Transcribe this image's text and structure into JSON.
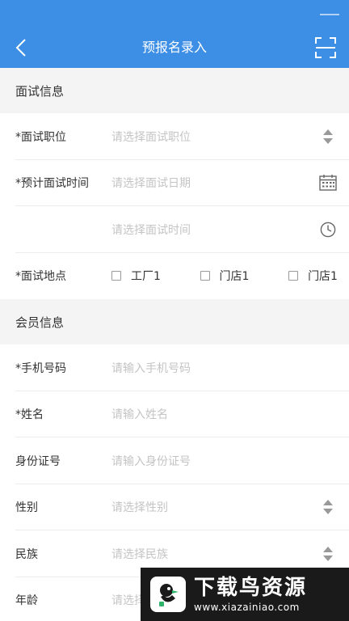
{
  "header": {
    "title": "预报名录入",
    "back_icon": "chevron-left-icon",
    "scan_icon": "scan-icon",
    "background": "#3d8fe6"
  },
  "sections": {
    "interview": {
      "title": "面试信息",
      "position": {
        "label": "*面试职位",
        "placeholder": "请选择面试职位"
      },
      "expected_time": {
        "label": "*预计面试时间",
        "date_placeholder": "请选择面试日期",
        "time_placeholder": "请选择面试时间"
      },
      "location": {
        "label": "*面试地点",
        "options": [
          "工厂1",
          "门店1",
          "门店1"
        ]
      }
    },
    "member": {
      "title": "会员信息",
      "phone": {
        "label": "*手机号码",
        "placeholder": "请输入手机号码"
      },
      "name": {
        "label": "*姓名",
        "placeholder": "请输入姓名"
      },
      "id_number": {
        "label": "身份证号",
        "placeholder": "请输入身份证号"
      },
      "gender": {
        "label": "性别",
        "placeholder": "请选择性别"
      },
      "ethnicity": {
        "label": "民族",
        "placeholder": "请选择民族"
      },
      "age": {
        "label": "年龄",
        "placeholder": "请选择"
      }
    }
  },
  "watermark": {
    "title": "下载鸟资源",
    "url": "www.xiazainiao.com"
  }
}
